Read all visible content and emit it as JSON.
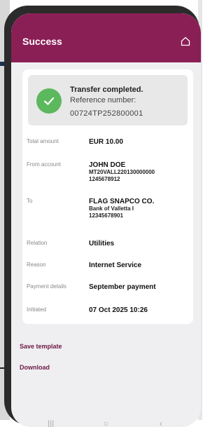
{
  "header": {
    "title": "Success",
    "icon": "home-icon"
  },
  "status": {
    "icon": "checkmark-icon",
    "title": "Transfer completed.",
    "reference_label": "Reference number:",
    "reference_number": "00724TP252800001"
  },
  "details": {
    "total_amount": {
      "label": "Total amount",
      "value": "EUR 10.00"
    },
    "from_account": {
      "label": "From account",
      "name": "JOHN DOE",
      "iban": "MT20VALL220130000000",
      "number": "1245678912"
    },
    "to": {
      "label": "To",
      "name": "FLAG SNAPCO CO.",
      "bank": "Bank of Valletta I",
      "account": "12345678901"
    },
    "relation": {
      "label": "Relation",
      "value": "Utilities"
    },
    "reason": {
      "label": "Reason",
      "value": "Internet Service"
    },
    "payment_details": {
      "label": "Payment details",
      "value": "September payment"
    },
    "initiated": {
      "label": "Initiated",
      "value": "07 Oct 2025 10:26"
    }
  },
  "actions": {
    "save_template": "Save template",
    "download": "Download"
  },
  "navbar": {
    "recent": "|||",
    "home": "○",
    "back": "‹"
  },
  "colors": {
    "brand": "#8a1f56",
    "success": "#5cb85c",
    "link": "#6e1844"
  }
}
